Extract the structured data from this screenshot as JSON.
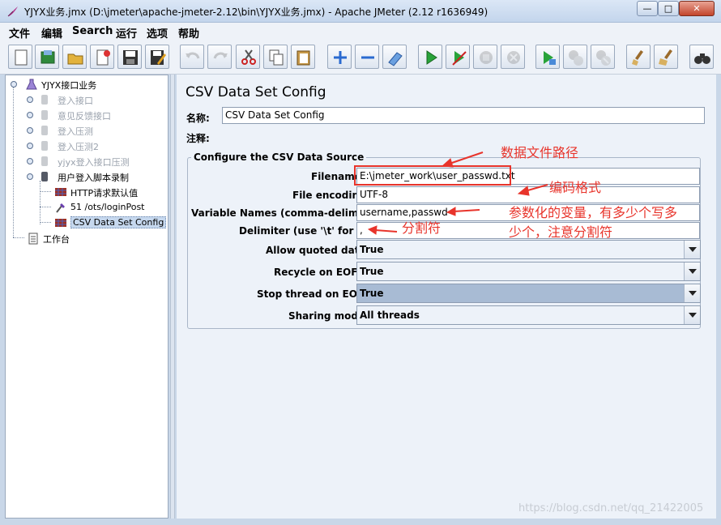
{
  "window": {
    "title": "YJYX业务.jmx (D:\\jmeter\\apache-jmeter-2.12\\bin\\YJYX业务.jmx) - Apache JMeter (2.12 r1636949)",
    "min_label": "—",
    "max_label": "□",
    "close_label": "✕"
  },
  "menu": [
    "文件",
    "编辑",
    "Search",
    "运行",
    "选项",
    "帮助"
  ],
  "toolbar": {
    "buttons": [
      {
        "name": "new-icon"
      },
      {
        "name": "templates-icon"
      },
      {
        "name": "open-icon"
      },
      {
        "name": "close-icon"
      },
      {
        "name": "save-icon"
      },
      {
        "name": "save-as-icon"
      },
      {
        "name": "undo-icon"
      },
      {
        "name": "redo-icon"
      },
      {
        "name": "cut-icon"
      },
      {
        "name": "copy-icon"
      },
      {
        "name": "paste-icon"
      },
      {
        "name": "expand-icon"
      },
      {
        "name": "collapse-icon"
      },
      {
        "name": "toggle-icon"
      },
      {
        "name": "start-icon"
      },
      {
        "name": "start-no-pauses-icon"
      },
      {
        "name": "stop-icon"
      },
      {
        "name": "shutdown-icon"
      },
      {
        "name": "remote-start-icon"
      },
      {
        "name": "remote-stop-icon"
      },
      {
        "name": "remote-shutdown-icon"
      },
      {
        "name": "clear-icon"
      },
      {
        "name": "clear-all-icon"
      },
      {
        "name": "search-icon"
      }
    ]
  },
  "tree": {
    "root": "YJYX接口业务",
    "items": [
      {
        "label": "登入接口",
        "disabled": true
      },
      {
        "label": "意见反馈接口",
        "disabled": true
      },
      {
        "label": "登入压测",
        "disabled": true
      },
      {
        "label": "登入压测2",
        "disabled": true
      },
      {
        "label": "yjyx登入接口压测",
        "disabled": true
      },
      {
        "label": "用户登入脚本录制",
        "disabled": false
      }
    ],
    "children": [
      {
        "label": "HTTP请求默认值"
      },
      {
        "label": "51 /ots/loginPost"
      },
      {
        "label": "CSV Data Set Config",
        "selected": true
      }
    ],
    "workbench": "工作台"
  },
  "panel": {
    "title": "CSV Data Set Config",
    "name_label": "名称:",
    "name_value": "CSV Data Set Config",
    "comment_label": "注释:",
    "comment_value": "",
    "section_title": "Configure the CSV Data Source",
    "fields": [
      {
        "label": "Filename",
        "value": "E:\\jmeter_work\\user_passwd.txt"
      },
      {
        "label": "File encoding:",
        "value": "UTF-8"
      },
      {
        "label": "Variable Names (comma-delimited):",
        "value": "username,passwd"
      },
      {
        "label": "Delimiter (use '\\t' for tab):",
        "value": ","
      }
    ],
    "selects": [
      {
        "label": "Allow quoted data?:",
        "value": "True"
      },
      {
        "label": "Recycle on EOF ?:",
        "value": "True"
      },
      {
        "label": "Stop thread on EOF ?:",
        "value": "True"
      },
      {
        "label": "Sharing mode:",
        "value": "All threads"
      }
    ]
  },
  "annotations": {
    "file_path": "数据文件路径",
    "encoding": "编码格式",
    "variables_line1": "参数化的变量，有多少个写多",
    "variables_line2": "少个，注意分割符",
    "delimiter": "分割符"
  },
  "watermark": "https://blog.csdn.net/qq_21422005",
  "colors": {
    "annotation": "#e8342b",
    "selection": "#c6d8ee"
  }
}
